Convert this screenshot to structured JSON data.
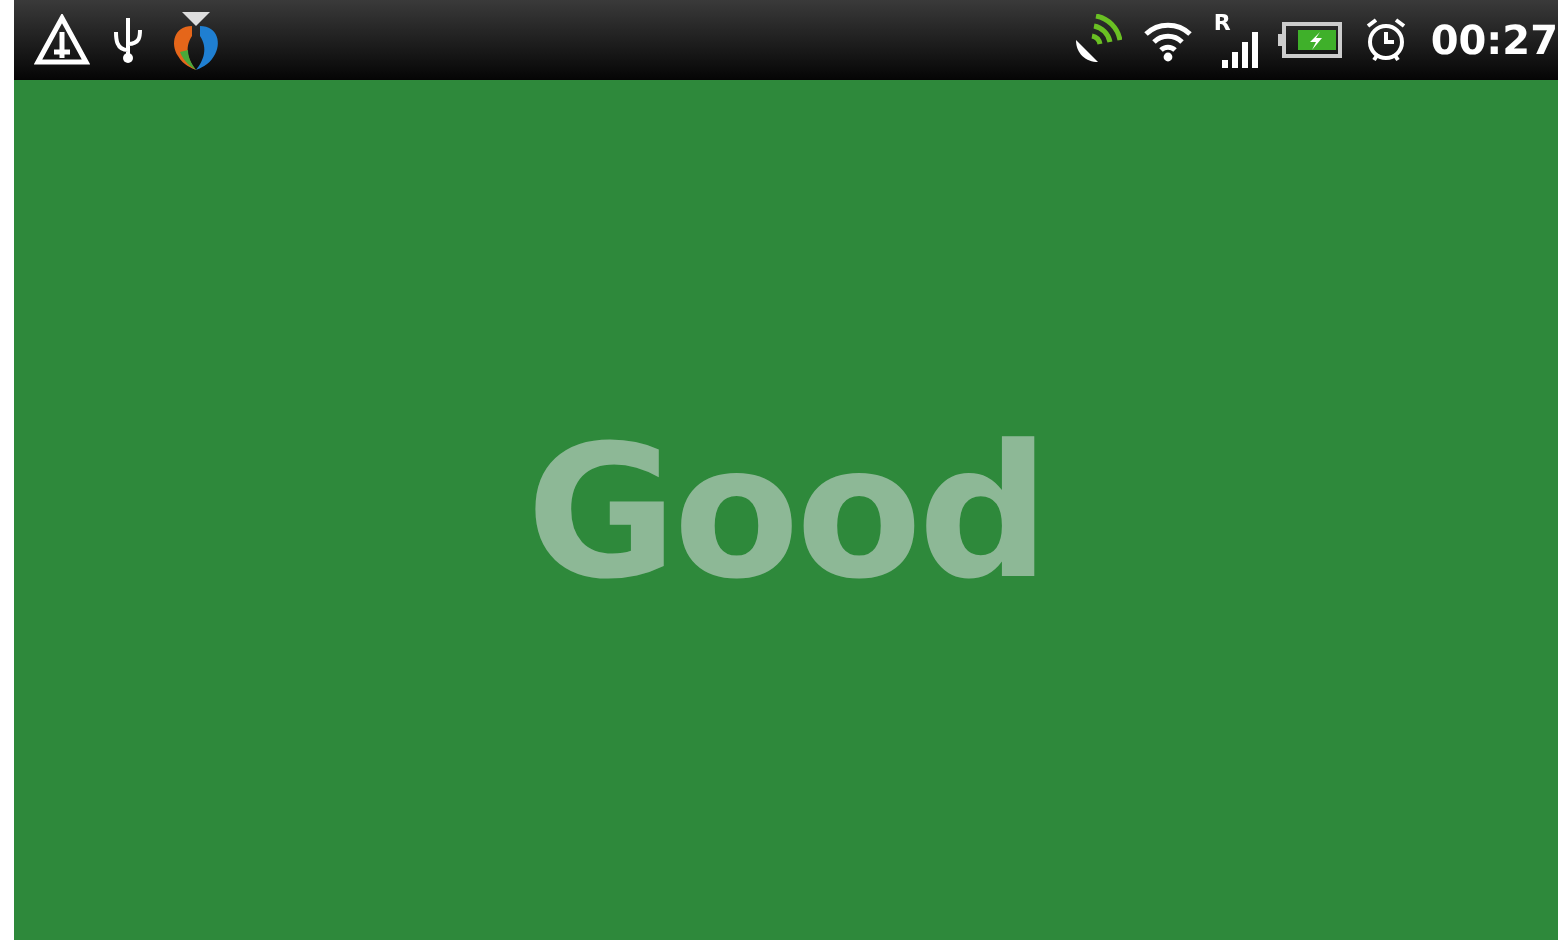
{
  "status_bar": {
    "roaming": "R",
    "time": "00:27"
  },
  "screen": {
    "message": "Good"
  }
}
